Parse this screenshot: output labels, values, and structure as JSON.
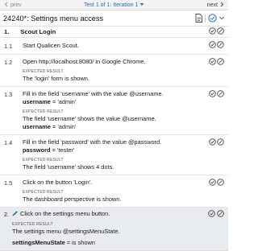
{
  "nav": {
    "prev_label": "prev",
    "center_label": "Test 1 of 1: Iteration 1",
    "next_label": "next"
  },
  "title": "24240*: Settings menu access",
  "section": {
    "num": "1.",
    "label": "Scout Login"
  },
  "expected_label": "EXPECTED RESULT",
  "steps": [
    {
      "num": "1.1",
      "text": "Start Qualicen Scout."
    },
    {
      "num": "1.2",
      "text": "Open http://localhost:8080/ in Google Chrome.",
      "expected": "The 'login' form is shown."
    },
    {
      "num": "1.3",
      "text": "Fill in the field 'username' with the value @username.",
      "param_key": "username",
      "param_val": " = 'admin'",
      "expected": "The field 'username' shows the value @username.",
      "exp_param_key": "username",
      "exp_param_val": " = 'admin'"
    },
    {
      "num": "1.4",
      "text": "Fill in the field 'password' with the value @password.",
      "param_key": "password",
      "param_val": " = 'tester'",
      "expected": "The field 'username' shows 4 dots."
    },
    {
      "num": "1.5",
      "text": "Click on the button 'Login'.",
      "expected": "The dashboard perspective is shown."
    }
  ],
  "active": {
    "num": "2.",
    "text": "Click on the settings menu button.",
    "expected": "The settings menu @settingsMenuState.",
    "param_key": "settingsMenuState",
    "param_val": " = is shown"
  },
  "colors": {
    "accent": "#2a6ab7",
    "active_bg": "#e9ecef"
  }
}
